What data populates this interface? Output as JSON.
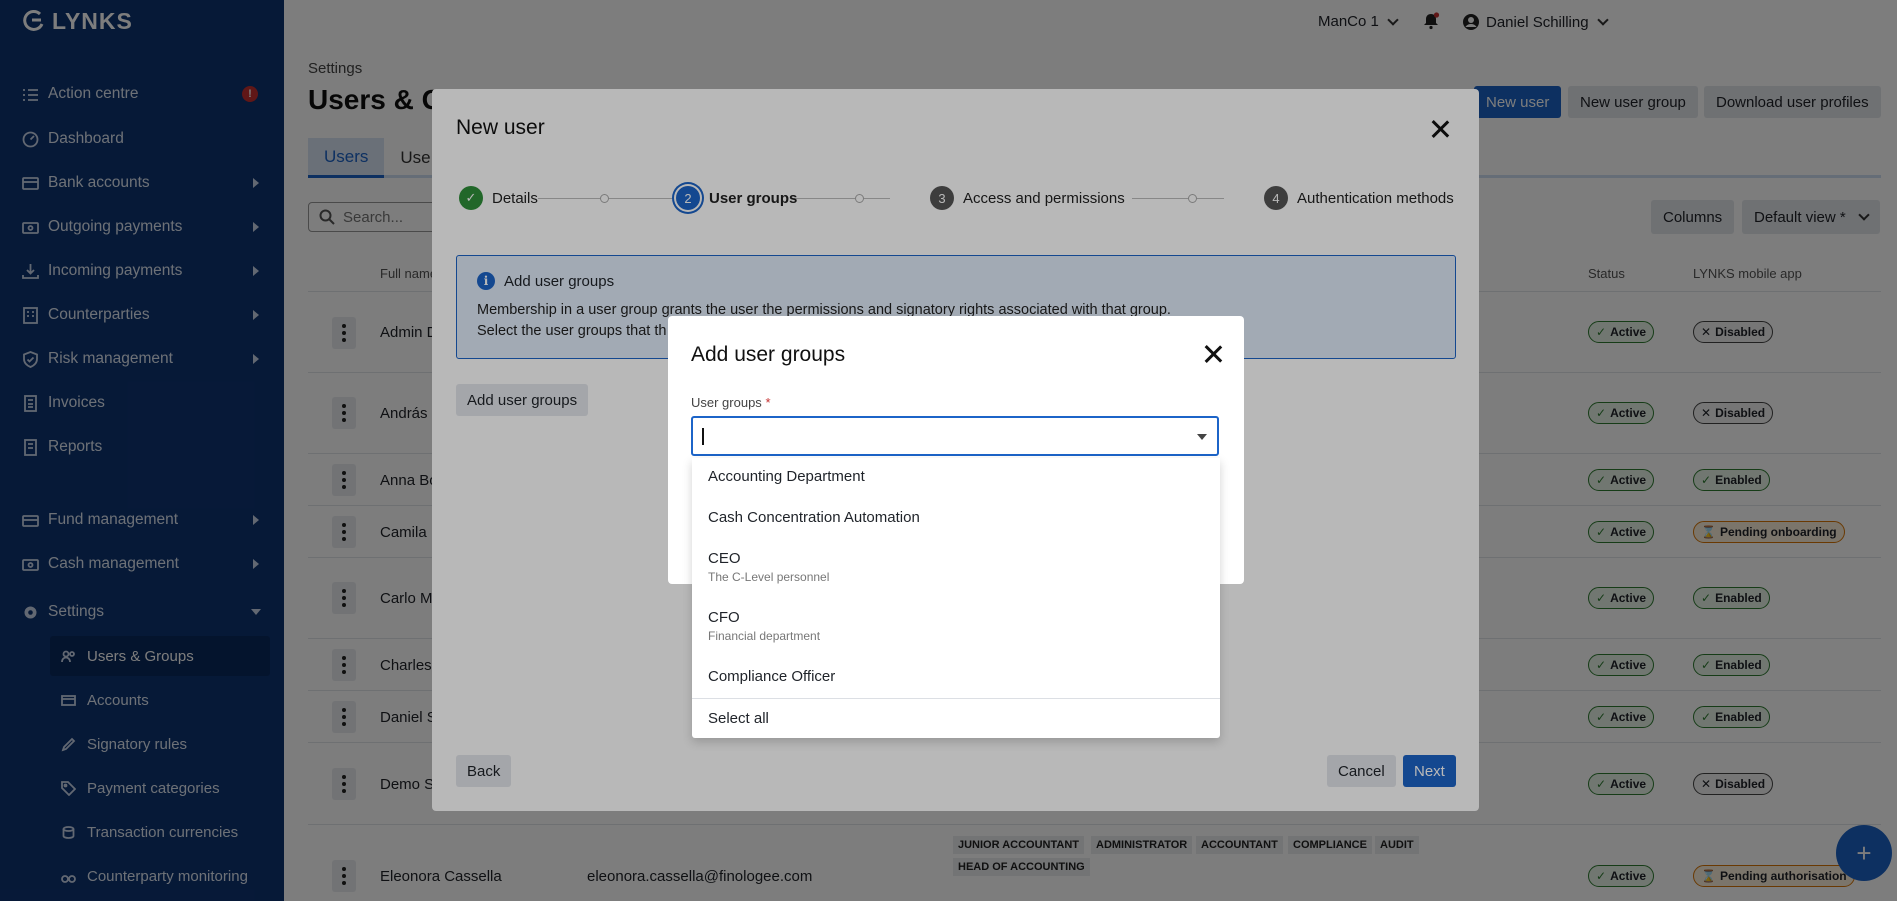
{
  "app": {
    "logo_text": "LYNKS"
  },
  "sidebar": {
    "items": [
      {
        "label": "Action centre",
        "badge": "!"
      },
      {
        "label": "Dashboard"
      },
      {
        "label": "Bank accounts"
      },
      {
        "label": "Outgoing payments"
      },
      {
        "label": "Incoming payments"
      },
      {
        "label": "Counterparties"
      },
      {
        "label": "Risk management"
      },
      {
        "label": "Invoices"
      },
      {
        "label": "Reports"
      },
      {
        "label": "Fund management"
      },
      {
        "label": "Cash management"
      },
      {
        "label": "Settings"
      }
    ],
    "settings_sub": [
      {
        "label": "Users & Groups"
      },
      {
        "label": "Accounts"
      },
      {
        "label": "Signatory rules"
      },
      {
        "label": "Payment categories"
      },
      {
        "label": "Transaction currencies"
      },
      {
        "label": "Counterparty monitoring"
      }
    ]
  },
  "topbar": {
    "entity": "ManCo 1",
    "user_name": "Daniel Schilling"
  },
  "page": {
    "breadcrumb": "Settings",
    "title": "Users & Gr",
    "buttons": {
      "new_user": "New user",
      "new_user_group": "New user group",
      "download": "Download user profiles"
    },
    "tabs": [
      "Users",
      "Use"
    ],
    "search_placeholder": "Search...",
    "columns_btn": "Columns",
    "view_btn": "Default view *",
    "headers": {
      "full_name": "Full name",
      "status": "Status",
      "mobile": "LYNKS mobile app"
    },
    "rows": [
      {
        "name": "Admin D",
        "status": "Active",
        "mobile": "Disabled"
      },
      {
        "name": "András",
        "status": "Active",
        "mobile": "Disabled"
      },
      {
        "name": "Anna Bo",
        "status": "Active",
        "mobile": "Enabled"
      },
      {
        "name": "Camila I",
        "status": "Active",
        "mobile": "Pending onboarding"
      },
      {
        "name": "Carlo M",
        "status": "Active",
        "mobile": "Enabled"
      },
      {
        "name": "Charles",
        "status": "Active",
        "mobile": "Enabled"
      },
      {
        "name": "Daniel S",
        "status": "Active",
        "mobile": "Enabled"
      },
      {
        "name": "Demo S",
        "status": "Active",
        "mobile": "Disabled"
      },
      {
        "name": "Eleonora Cassella",
        "email": "eleonora.cassella@finologee.com",
        "status": "Active",
        "mobile": "Pending authorisation",
        "tags": [
          "JUNIOR ACCOUNTANT",
          "ADMINISTRATOR",
          "ACCOUNTANT",
          "COMPLIANCE",
          "AUDIT",
          "HEAD OF ACCOUNTING"
        ]
      }
    ]
  },
  "new_user_modal": {
    "title": "New user",
    "steps": [
      {
        "num": "1",
        "label": "Details"
      },
      {
        "num": "2",
        "label": "User groups"
      },
      {
        "num": "3",
        "label": "Access and permissions"
      },
      {
        "num": "4",
        "label": "Authentication methods"
      }
    ],
    "info": {
      "icon": "i",
      "title": "Add user groups",
      "line1": "Membership in a user group grants the user the permissions and signatory rights associated with that group.",
      "line2": "Select the user groups that th"
    },
    "add_groups_btn": "Add user groups",
    "back_btn": "Back",
    "cancel_btn": "Cancel",
    "next_btn": "Next"
  },
  "add_groups_dialog": {
    "title": "Add user groups",
    "field_label": "User groups",
    "required_mark": "*",
    "input_value": "",
    "options": [
      {
        "label": "Accounting Department",
        "sub": ""
      },
      {
        "label": "Cash Concentration Automation",
        "sub": ""
      },
      {
        "label": "CEO",
        "sub": "The C-Level personnel"
      },
      {
        "label": "CFO",
        "sub": "Financial department"
      },
      {
        "label": "Compliance Officer",
        "sub": ""
      }
    ],
    "select_all": "Select all"
  },
  "colors": {
    "sidebar_bg": "#0e3472",
    "primary": "#1c64c8",
    "success": "#2f7d32",
    "warning": "#d97706"
  }
}
